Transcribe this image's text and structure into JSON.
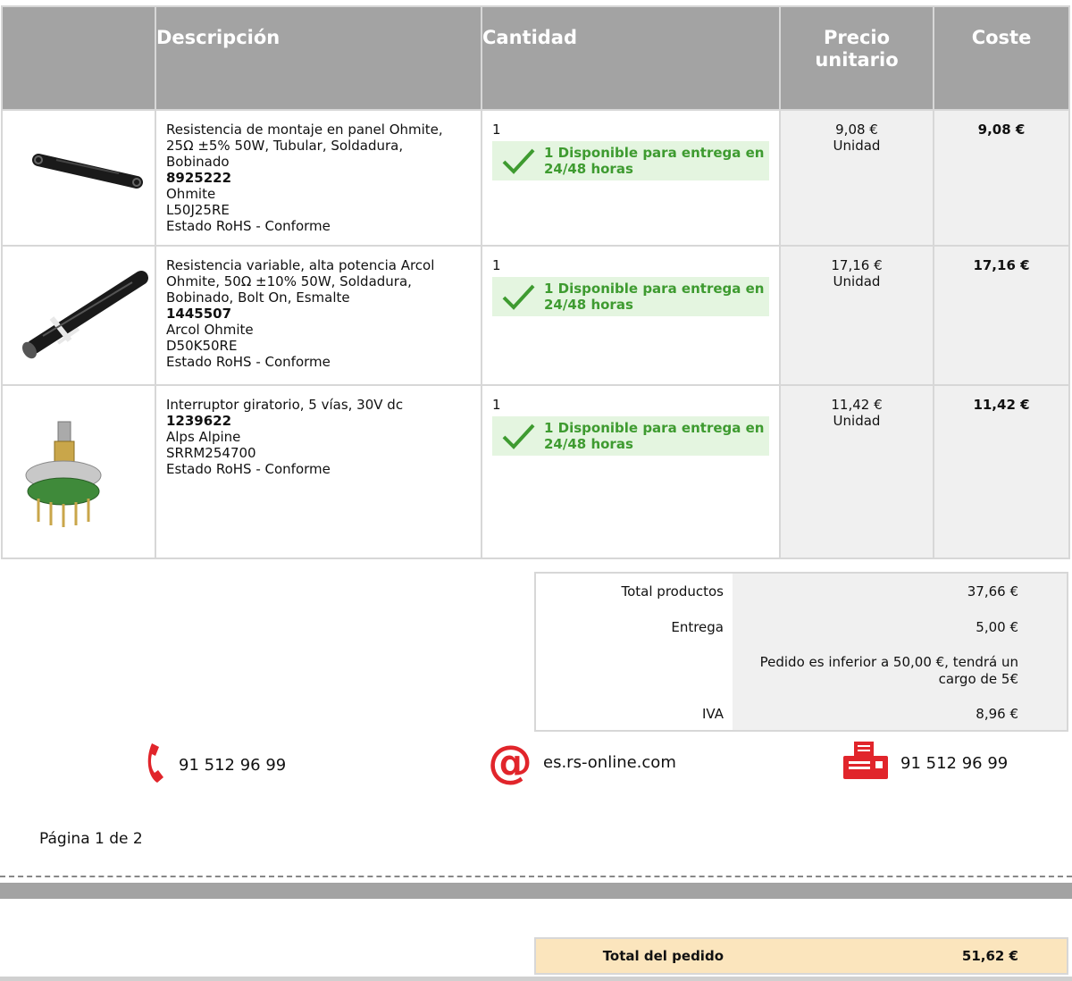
{
  "header": {
    "description": "Descripción",
    "quantity": "Cantidad",
    "unit_price_line1": "Precio",
    "unit_price_line2": "unitario",
    "cost": "Coste"
  },
  "items": [
    {
      "image": "tubular-resistor-image",
      "desc_lines": [
        "Resistencia de montaje en panel Ohmite,",
        "25Ω ±5% 50W, Tubular, Soldadura,",
        "Bobinado"
      ],
      "code": "8925222",
      "brand": "Ohmite",
      "part": "L50J25RE",
      "rohs": "Estado RoHS - Conforme",
      "qty": "1",
      "avail_line1": "1 Disponible para entrega en",
      "avail_line2": "24/48 horas",
      "price": "9,08 €",
      "unit": "Unidad",
      "cost": "9,08 €"
    },
    {
      "image": "rheostat-resistor-image",
      "desc_lines": [
        "Resistencia variable, alta potencia Arcol",
        "Ohmite, 50Ω ±10% 50W, Soldadura,",
        "Bobinado, Bolt On, Esmalte"
      ],
      "code": "1445507",
      "brand": "Arcol Ohmite",
      "part": "D50K50RE",
      "rohs": "Estado RoHS - Conforme",
      "qty": "1",
      "avail_line1": "1 Disponible para entrega en",
      "avail_line2": "24/48 horas",
      "price": "17,16 €",
      "unit": "Unidad",
      "cost": "17,16 €"
    },
    {
      "image": "rotary-switch-image",
      "desc_lines": [
        "Interruptor giratorio, 5 vías, 30V dc"
      ],
      "code": "1239622",
      "brand": "Alps Alpine",
      "part": "SRRM254700",
      "rohs": "Estado RoHS - Conforme",
      "qty": "1",
      "avail_line1": "1 Disponible para entrega en",
      "avail_line2": "24/48 horas",
      "price": "11,42 €",
      "unit": "Unidad",
      "cost": "11,42 €"
    }
  ],
  "totals": {
    "products_label": "Total productos",
    "products_value": "37,66 €",
    "delivery_label": "Entrega",
    "delivery_value": "5,00 €",
    "delivery_note_line1": "Pedido es inferior a 50,00 €, tendrá un",
    "delivery_note_line2": "cargo de 5€",
    "vat_label": "IVA",
    "vat_value": "8,96 €"
  },
  "contacts": {
    "phone": "91 512 96 99",
    "web": "es.rs-online.com",
    "fax": "91 512 96 99"
  },
  "page": "Página 1 de 2",
  "order_total": {
    "label": "Total del pedido",
    "value": "51,62 €"
  },
  "colors": {
    "header_bg": "#a3a3a3",
    "avail_bg": "#e4f5e0",
    "avail_text": "#3e9b30",
    "price_bg": "#f0f0f0",
    "order_total_bg": "#fbe5bd",
    "icon_red": "#e1252b"
  }
}
